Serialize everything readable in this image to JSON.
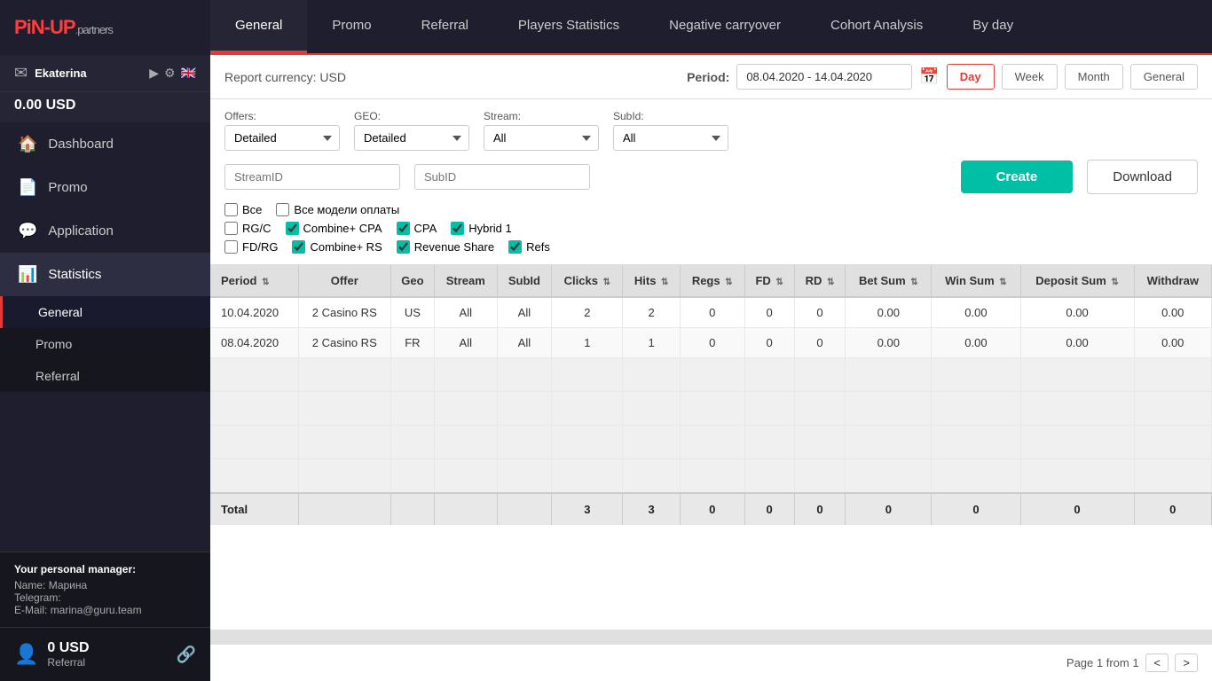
{
  "logo": {
    "pin": "PiN",
    "up": "-UP",
    "dot": ".",
    "partners": "partners"
  },
  "sidebar": {
    "user": {
      "name": "Ekaterina",
      "balance": "0.00 USD"
    },
    "nav_items": [
      {
        "id": "dashboard",
        "label": "Dashboard",
        "icon": "🏠"
      },
      {
        "id": "promo",
        "label": "Promo",
        "icon": "📄"
      },
      {
        "id": "application",
        "label": "Application",
        "icon": "💬"
      },
      {
        "id": "statistics",
        "label": "Statistics",
        "icon": "📊",
        "active": true
      }
    ],
    "sub_items": [
      {
        "id": "general",
        "label": "General",
        "active": true
      },
      {
        "id": "promo-sub",
        "label": "Promo"
      },
      {
        "id": "referral",
        "label": "Referral"
      }
    ],
    "personal_manager": {
      "title": "Your personal manager:",
      "name_label": "Name:",
      "name": "Марина",
      "telegram_label": "Telegram:",
      "telegram": "",
      "email_label": "E-Mail:",
      "email": "marina@guru.team"
    },
    "footer": {
      "balance": "0 USD",
      "label": "Referral"
    }
  },
  "topnav": {
    "items": [
      {
        "id": "general",
        "label": "General",
        "active": true
      },
      {
        "id": "promo",
        "label": "Promo"
      },
      {
        "id": "referral",
        "label": "Referral"
      },
      {
        "id": "players-statistics",
        "label": "Players Statistics"
      },
      {
        "id": "negative-carryover",
        "label": "Negative carryover"
      },
      {
        "id": "cohort-analysis",
        "label": "Cohort Analysis"
      },
      {
        "id": "by-day",
        "label": "By day"
      }
    ]
  },
  "report": {
    "currency_label": "Report currency: USD",
    "period_label": "Period:",
    "period_value": "08.04.2020 - 14.04.2020",
    "period_buttons": [
      "Day",
      "Week",
      "Month",
      "General"
    ],
    "active_period_btn": "Day"
  },
  "filters": {
    "offers_label": "Offers:",
    "offers_value": "Detailed",
    "geo_label": "GEO:",
    "geo_value": "Detailed",
    "stream_label": "Stream:",
    "stream_value": "All",
    "subid_label": "SubId:",
    "subid_value": "All",
    "stream_id_placeholder": "StreamID",
    "subid_placeholder": "SubID",
    "create_btn": "Create",
    "download_btn": "Download",
    "checkboxes": [
      {
        "id": "vse",
        "label": "Все",
        "checked": false
      },
      {
        "id": "vse-modeli",
        "label": "Все модели оплаты",
        "checked": false
      },
      {
        "id": "rg-c",
        "label": "RG/C",
        "checked": false
      },
      {
        "id": "combine-cpa",
        "label": "Combine+ CPA",
        "checked": true
      },
      {
        "id": "cpa",
        "label": "CPA",
        "checked": true
      },
      {
        "id": "hybrid-1",
        "label": "Hybrid 1",
        "checked": true
      },
      {
        "id": "fd-rg",
        "label": "FD/RG",
        "checked": false
      },
      {
        "id": "combine-rs",
        "label": "Combine+ RS",
        "checked": true
      },
      {
        "id": "revenue-share",
        "label": "Revenue Share",
        "checked": true
      },
      {
        "id": "refs",
        "label": "Refs",
        "checked": true
      }
    ]
  },
  "table": {
    "columns": [
      "Period",
      "Offer",
      "Geo",
      "Stream",
      "SubId",
      "Clicks",
      "Hits",
      "Regs",
      "FD",
      "RD",
      "Bet Sum",
      "Win Sum",
      "Deposit Sum",
      "Withdraw"
    ],
    "rows": [
      {
        "period": "10.04.2020",
        "offer": "2 Casino RS",
        "geo": "US",
        "stream": "All",
        "subid": "All",
        "clicks": "2",
        "hits": "2",
        "regs": "0",
        "fd": "0",
        "rd": "0",
        "bet_sum": "0.00",
        "win_sum": "0.00",
        "deposit_sum": "0.00",
        "withdraw": "0.00"
      },
      {
        "period": "08.04.2020",
        "offer": "2 Casino RS",
        "geo": "FR",
        "stream": "All",
        "subid": "All",
        "clicks": "1",
        "hits": "1",
        "regs": "0",
        "fd": "0",
        "rd": "0",
        "bet_sum": "0.00",
        "win_sum": "0.00",
        "deposit_sum": "0.00",
        "withdraw": "0.00"
      }
    ],
    "empty_rows": 4,
    "footer": {
      "label": "Total",
      "clicks": "3",
      "hits": "3",
      "regs": "0",
      "fd": "0",
      "rd": "0",
      "bet_sum": "0",
      "win_sum": "0",
      "deposit_sum": "0",
      "withdraw": "0"
    }
  },
  "pagination": {
    "text": "Page 1 from 1",
    "prev": "<",
    "next": ">"
  }
}
